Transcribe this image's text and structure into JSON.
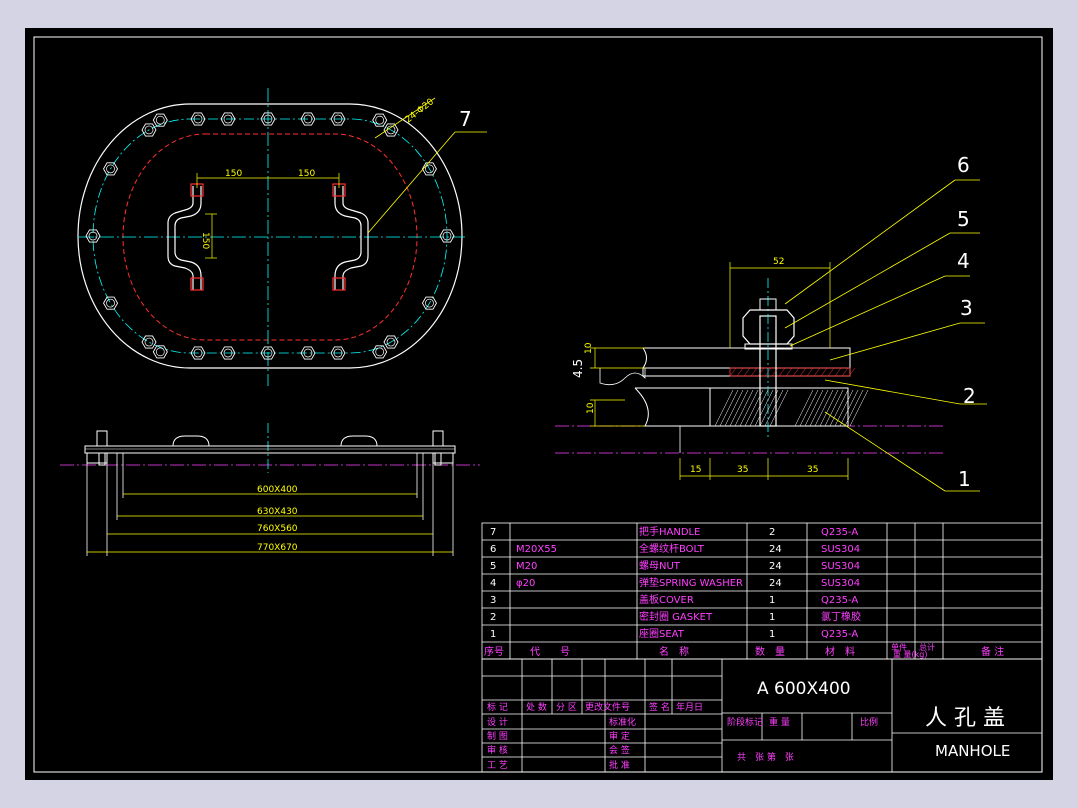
{
  "callouts": [
    "7",
    "6",
    "5",
    "4",
    "3",
    "2",
    "1"
  ],
  "top_view": {
    "dim_hole": "24-Φ20",
    "dim_left": "150",
    "dim_right": "150",
    "dim_height": "150"
  },
  "side_view": {
    "dims": [
      "600X400",
      "630X430",
      "760X560",
      "770X670"
    ]
  },
  "section_view": {
    "dim_top": "52",
    "dim_10a": "10",
    "dim_45": "4.5",
    "dim_10b": "10",
    "dim_b1": "15",
    "dim_b2": "35",
    "dim_b3": "35"
  },
  "bom": {
    "rows": [
      {
        "no": "7",
        "code": "",
        "name": "把手HANDLE",
        "qty": "2",
        "mat": "Q235-A"
      },
      {
        "no": "6",
        "code": "M20X55",
        "name": "全螺纹杆BOLT",
        "qty": "24",
        "mat": "SUS304"
      },
      {
        "no": "5",
        "code": "M20",
        "name": "螺母NUT",
        "qty": "24",
        "mat": "SUS304"
      },
      {
        "no": "4",
        "code": "φ20",
        "name": "弹垫SPRING WASHER",
        "qty": "24",
        "mat": "SUS304"
      },
      {
        "no": "3",
        "code": "",
        "name": "盖板COVER",
        "qty": "1",
        "mat": "Q235-A"
      },
      {
        "no": "2",
        "code": "",
        "name": "密封圈 GASKET",
        "qty": "1",
        "mat": "氯丁橡胶"
      },
      {
        "no": "1",
        "code": "",
        "name": "座圈SEAT",
        "qty": "1",
        "mat": "Q235-A"
      }
    ],
    "header": {
      "no": "序号",
      "code": "代　　号",
      "name": "名　称",
      "qty": "数　量",
      "mat": "材　料",
      "w1": "单件",
      "w2": "总计",
      "wt": "重 量(kg)",
      "note": "备 注"
    }
  },
  "title_block": {
    "model": "A 600X400",
    "title_cn": "人 孔 盖",
    "title_en": "MANHOLE",
    "rev_labels": [
      "标 记",
      "处 数",
      "分 区",
      "更改文件号",
      "签 名",
      "年月日"
    ],
    "role_labels": [
      "设 计",
      "制 图",
      "审 核",
      "工 艺"
    ],
    "role_labels2": [
      "标准化",
      "审 定",
      "会 签",
      "批 准"
    ],
    "stage_labels": [
      "阶段标记",
      "重 量",
      "比例"
    ],
    "sheets": "共　张 第　张"
  }
}
